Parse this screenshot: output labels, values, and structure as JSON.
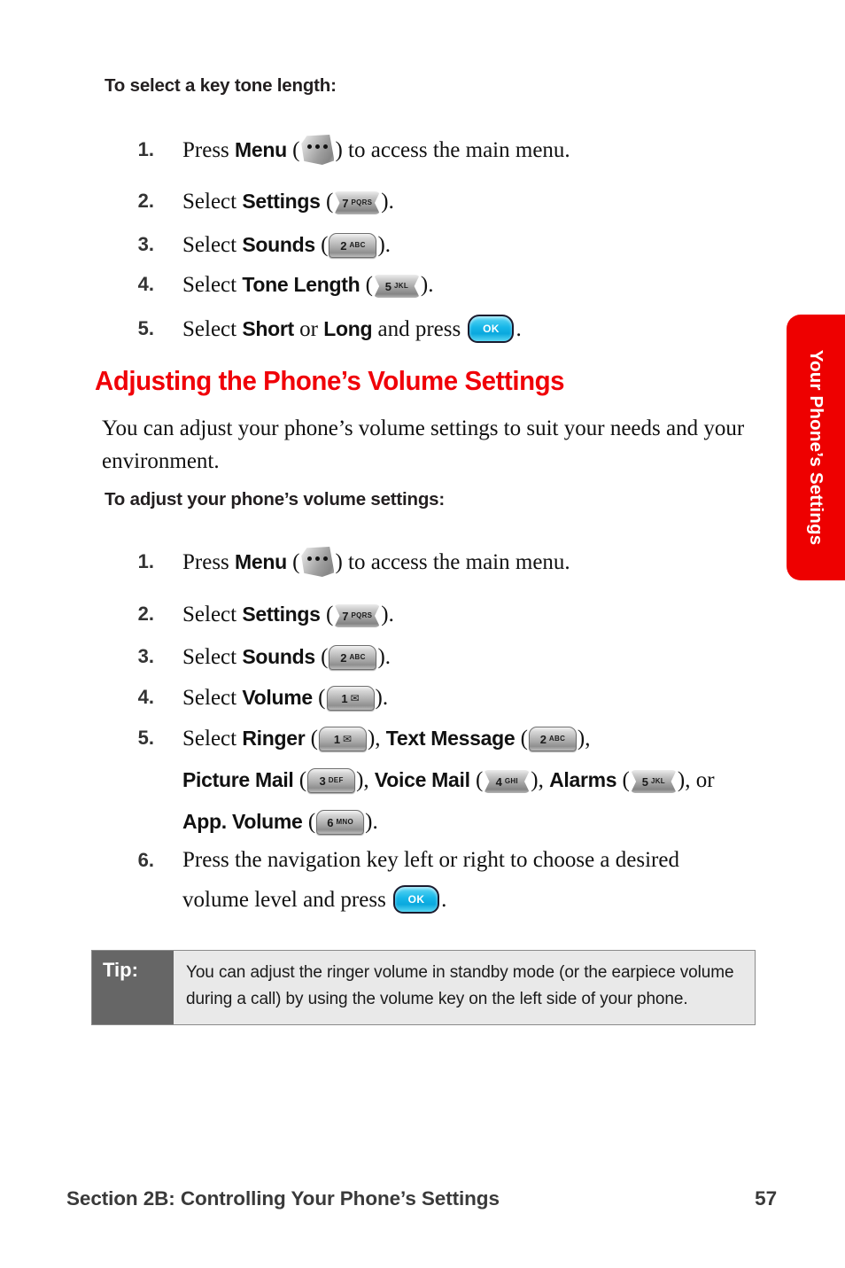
{
  "side_tab": {
    "label": "Your Phone’s Settings",
    "color": "#ee0000",
    "text_color": "#ffffff"
  },
  "section_one": {
    "heading": "To select a key tone length:",
    "steps": [
      {
        "number": "1.",
        "pre": "Press ",
        "bold": "Menu",
        "mid": " (",
        "key": "menu",
        "post": ") to access the main menu."
      },
      {
        "number": "2.",
        "pre": "Select ",
        "bold": "Settings",
        "mid": " (",
        "key": "7",
        "post": ")."
      },
      {
        "number": "3.",
        "pre": "Select ",
        "bold": "Sounds",
        "mid": " (",
        "key": "2",
        "post": ")."
      },
      {
        "number": "4.",
        "pre": "Select ",
        "bold": "Tone Length",
        "mid": " (",
        "key": "5",
        "post": ")."
      },
      {
        "number": "5.",
        "pre": "Select ",
        "bold": "Short",
        "mid": " or ",
        "bold2": "Long",
        "post": " and press ",
        "key": "ok",
        "tail": "."
      }
    ]
  },
  "section_two": {
    "title": "Adjusting the Phone’s Volume Settings",
    "title_color": "#f00008",
    "paragraph": "You can adjust your phone’s volume settings to suit your needs and your environment.",
    "sub_heading": "To adjust your phone’s volume settings:",
    "steps": [
      {
        "number": "1.",
        "pre": "Press ",
        "bold": "Menu",
        "mid": " (",
        "key": "menu",
        "post": ") to access the main menu."
      },
      {
        "number": "2.",
        "pre": "Select ",
        "bold": "Settings",
        "mid": " (",
        "key": "7",
        "post": ")."
      },
      {
        "number": "3.",
        "pre": "Select ",
        "bold": "Sounds",
        "mid": " (",
        "key": "2",
        "post": ")."
      },
      {
        "number": "4.",
        "pre": "Select ",
        "bold": "Volume",
        "mid": " (",
        "key": "1",
        "post": ")."
      },
      {
        "number": "5.",
        "pre": "Select ",
        "parts": [
          {
            "bold": "Ringer",
            "key": "1",
            "after": ", "
          },
          {
            "bold": "Text Message",
            "key": "2",
            "after": ", "
          },
          {
            "bold": "Picture Mail",
            "key": "3",
            "after": ", "
          },
          {
            "bold": "Voice Mail",
            "key": "4",
            "after": ", "
          },
          {
            "bold": "Alarms",
            "key": "5",
            "after": ", or "
          },
          {
            "bold": "App. Volume",
            "key": "6",
            "after": "."
          }
        ]
      },
      {
        "number": "6.",
        "pre": "Press the navigation key left or right to choose a desired volume level and press ",
        "key": "ok",
        "post": "."
      }
    ]
  },
  "tip": {
    "label": "Tip:",
    "text": "You can adjust the ringer volume in standby mode (or the earpiece volume during a call) by using the volume key on the left side of your phone.",
    "label_bg": "#666666",
    "body_bg": "#e9e9e9"
  },
  "footer": {
    "section": "Section 2B: Controlling Your Phone’s Settings",
    "page_number": "57"
  },
  "keys": {
    "menu": {
      "name": "menu-key",
      "glyph": "•••"
    },
    "ok": {
      "name": "ok-key",
      "label": "OK"
    },
    "1": {
      "digit": "1",
      "letters": "✉"
    },
    "2": {
      "digit": "2",
      "letters": "ABC"
    },
    "3": {
      "digit": "3",
      "letters": "DEF"
    },
    "4": {
      "digit": "4",
      "letters": "GHI"
    },
    "5": {
      "digit": "5",
      "letters": "JKL"
    },
    "6": {
      "digit": "6",
      "letters": "MNO"
    },
    "7": {
      "digit": "7",
      "letters": "PQRS"
    }
  }
}
